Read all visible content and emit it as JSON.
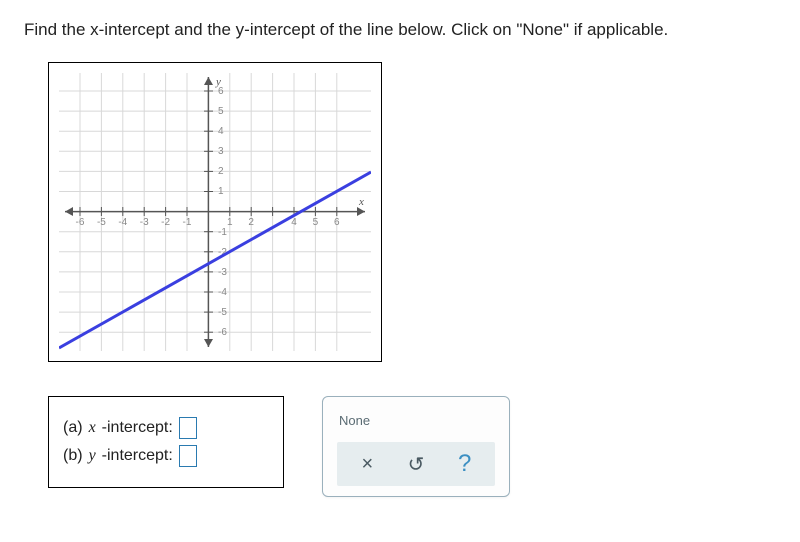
{
  "question": "Find the x-intercept and the y-intercept of the line below. Click on \"None\" if applicable.",
  "chart_data": {
    "type": "line",
    "xlabel": "x",
    "ylabel": "y",
    "xlim": [
      -6.6,
      6.6
    ],
    "ylim": [
      -6.6,
      6.6
    ],
    "xticks": [
      -6,
      -5,
      -4,
      -3,
      -2,
      -1,
      1,
      2,
      3,
      4,
      5,
      6
    ],
    "yticks": [
      -6,
      -5,
      -4,
      -3,
      -2,
      -1,
      1,
      2,
      3,
      4,
      5,
      6
    ],
    "grid": true,
    "series": [
      {
        "name": "line",
        "points": [
          [
            -6,
            -7.25
          ],
          [
            6,
            1.75
          ]
        ],
        "slope": 0.75,
        "y_intercept": -2.75,
        "x_intercept": 3.6667
      }
    ]
  },
  "answers": {
    "a_label_prefix": "(a) ",
    "a_var": "x",
    "a_label_suffix": "-intercept:",
    "b_label_prefix": "(b) ",
    "b_var": "y",
    "b_label_suffix": "-intercept:",
    "a_value": "",
    "b_value": ""
  },
  "palette": {
    "none_label": "None",
    "clear_icon": "×",
    "reset_icon": "↺",
    "help_icon": "?"
  }
}
